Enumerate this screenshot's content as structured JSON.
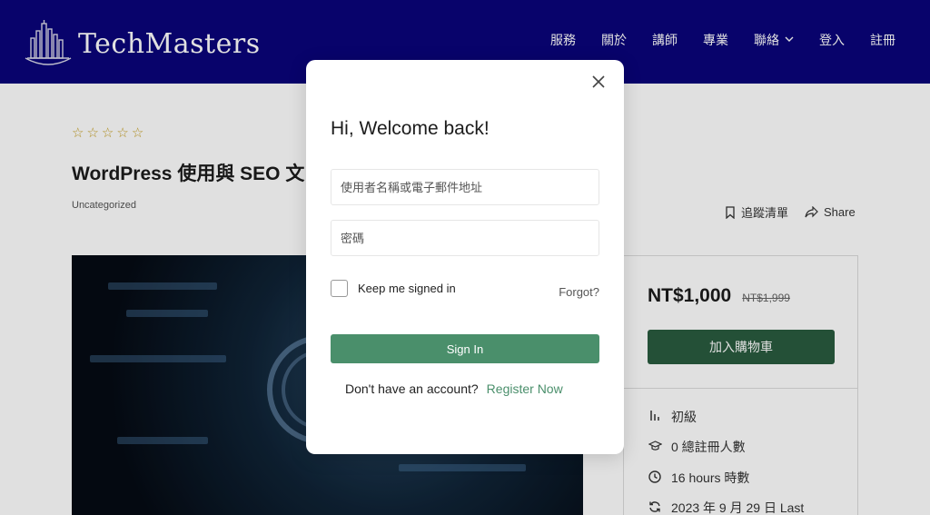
{
  "header": {
    "brand": "TechMasters",
    "nav": [
      {
        "label": "服務"
      },
      {
        "label": "關於"
      },
      {
        "label": "講師"
      },
      {
        "label": "專業"
      },
      {
        "label": "聯絡"
      },
      {
        "label": "登入"
      },
      {
        "label": "註冊"
      }
    ],
    "bg_color": "#0a047a"
  },
  "course": {
    "rating_stars": 0,
    "title": "WordPress 使用與 SEO 文",
    "category": "Uncategorized",
    "wishlist_label": "追蹤清單",
    "share_label": "Share"
  },
  "sidebar": {
    "price": "NT$1,000",
    "old_price": "NT$1,999",
    "add_to_cart": "加入購物車",
    "level": "初級",
    "enrolled": "0 總註冊人數",
    "duration": "16 hours  時數",
    "updated": "2023 年 9 月 29 日  Last",
    "accent_color": "#2a5c3f"
  },
  "modal": {
    "title": "Hi, Welcome back!",
    "username_placeholder": "使用者名稱或電子郵件地址",
    "password_placeholder": "密碼",
    "remember_label": "Keep me signed in",
    "forgot_label": "Forgot?",
    "signin_label": "Sign In",
    "no_account_text": "Don't have an account?",
    "register_label": "Register Now",
    "accent_color": "#4a8f6b"
  }
}
